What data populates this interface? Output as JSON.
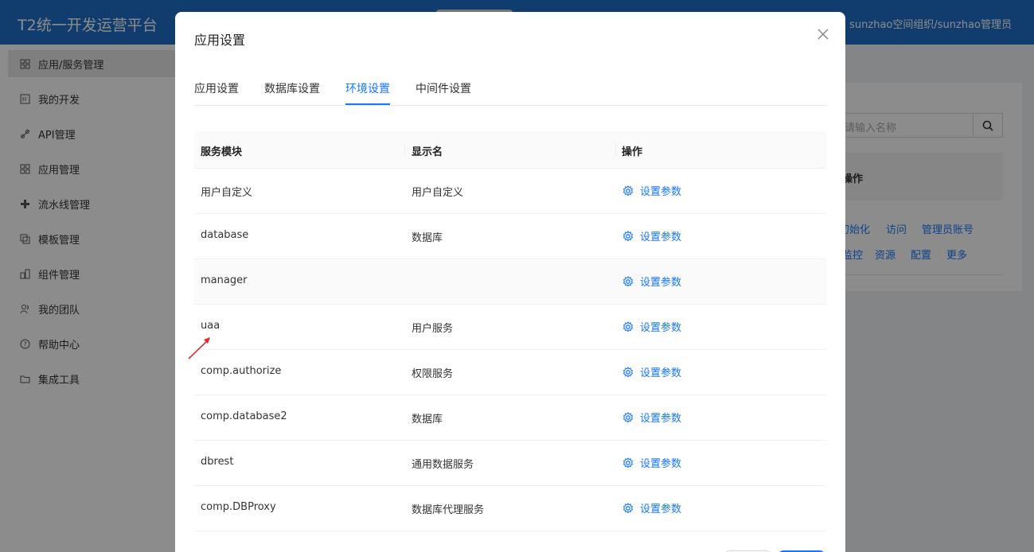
{
  "app": {
    "brand": "T2统一开发运营平台",
    "user": "sunzhao空间组织/sunzhao管理员"
  },
  "sidebar": {
    "items": [
      {
        "label": "应用/服务管理",
        "icon": "app-grid-icon",
        "active": true
      },
      {
        "label": "我的开发",
        "icon": "dev-icon"
      },
      {
        "label": "API管理",
        "icon": "api-link-icon"
      },
      {
        "label": "应用管理",
        "icon": "apps-icon"
      },
      {
        "label": "流水线管理",
        "icon": "pipeline-icon"
      },
      {
        "label": "模板管理",
        "icon": "template-icon"
      },
      {
        "label": "组件管理",
        "icon": "component-icon"
      },
      {
        "label": "我的团队",
        "icon": "team-icon"
      },
      {
        "label": "帮助中心",
        "icon": "help-icon"
      },
      {
        "label": "集成工具",
        "icon": "folder-icon"
      }
    ]
  },
  "background": {
    "search_placeholder": "请输入名称",
    "ops_header": "操作",
    "links_row1": [
      "初始化",
      "访问",
      "管理员账号"
    ],
    "links_row2": [
      "监控",
      "资源",
      "配置",
      "更多"
    ]
  },
  "modal": {
    "title": "应用设置",
    "tabs": [
      {
        "label": "应用设置",
        "active": false
      },
      {
        "label": "数据库设置",
        "active": false
      },
      {
        "label": "环境设置",
        "active": true
      },
      {
        "label": "中间件设置",
        "active": false
      }
    ],
    "columns": [
      "服务模块",
      "显示名",
      "操作"
    ],
    "action_label": "设置参数",
    "rows": [
      {
        "module": "用户自定义",
        "display": "用户自定义"
      },
      {
        "module": "database",
        "display": "数据库"
      },
      {
        "module": "manager",
        "display": ""
      },
      {
        "module": "uaa",
        "display": "用户服务"
      },
      {
        "module": "comp.authorize",
        "display": "权限服务"
      },
      {
        "module": "comp.database2",
        "display": "数据库"
      },
      {
        "module": "dbrest",
        "display": "通用数据服务"
      },
      {
        "module": "comp.DBProxy",
        "display": "数据库代理服务"
      }
    ]
  },
  "colors": {
    "topbar": "#1e6fc8",
    "accent": "#1677ff",
    "annotation_arrow": "#e0282e"
  }
}
